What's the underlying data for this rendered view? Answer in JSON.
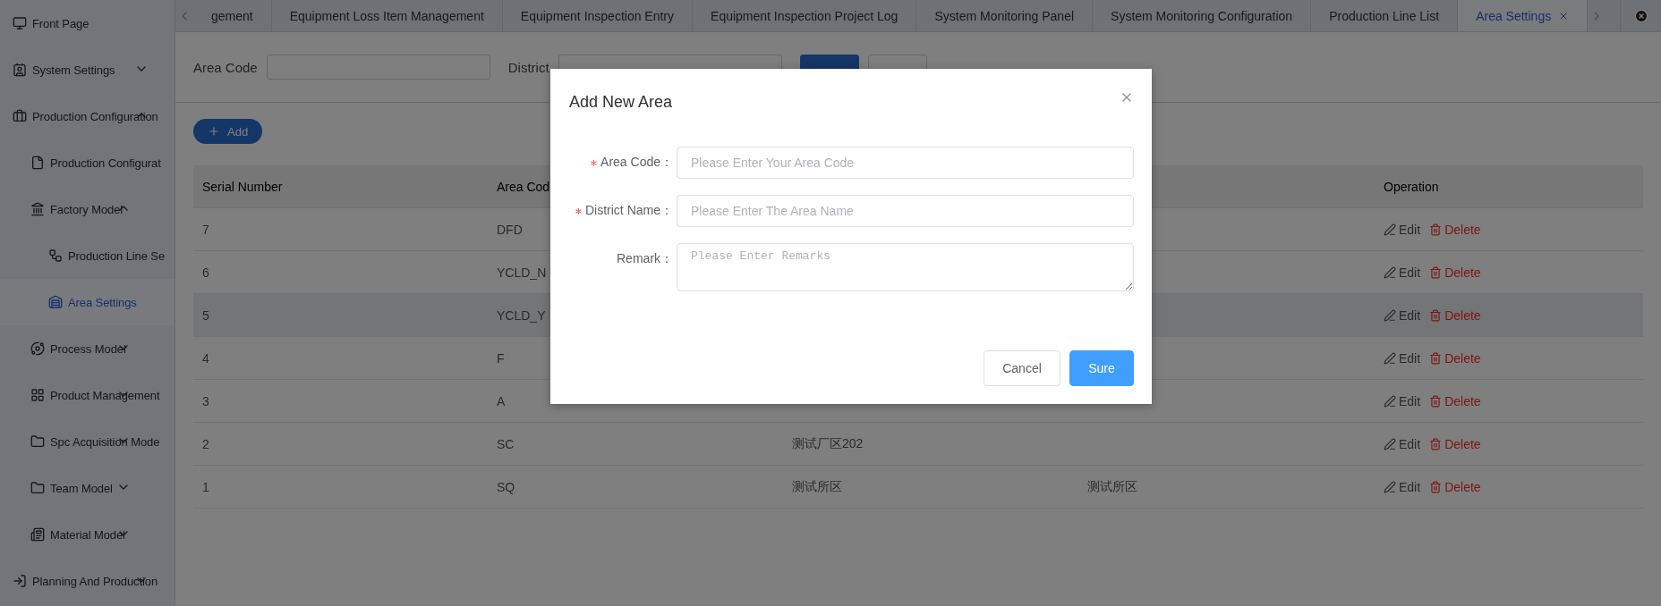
{
  "sidebar": {
    "items": [
      {
        "label": "Front Page",
        "selected": false
      },
      {
        "label": "System Settings",
        "kind": "group",
        "expanded": false,
        "selected": false
      },
      {
        "label": "Production Configuration",
        "kind": "group",
        "expanded": true,
        "selected": false,
        "children": [
          {
            "label": "Production Configurat",
            "selected": false
          },
          {
            "label": "Factory Model",
            "kind": "group",
            "expanded": true,
            "selected": false,
            "children": [
              {
                "label": "Production Line Se",
                "selected": false
              },
              {
                "label": "Area Settings",
                "selected": true
              }
            ]
          },
          {
            "label": "Process Model",
            "kind": "group",
            "expanded": false,
            "selected": false
          },
          {
            "label": "Product Management",
            "kind": "group",
            "expanded": false,
            "selected": false
          },
          {
            "label": "Spc Acquisition Mode",
            "kind": "group",
            "expanded": false,
            "selected": false
          },
          {
            "label": "Team Model",
            "kind": "group",
            "expanded": false,
            "selected": false
          },
          {
            "label": "Material Model",
            "kind": "group",
            "expanded": false,
            "selected": false
          }
        ]
      },
      {
        "label": "Planning And Production",
        "kind": "group",
        "expanded": false,
        "selected": false
      }
    ]
  },
  "tabs": [
    {
      "label": "gement",
      "selected": false
    },
    {
      "label": "Equipment Loss Item Management",
      "selected": false
    },
    {
      "label": "Equipment Inspection Entry",
      "selected": false
    },
    {
      "label": "Equipment Inspection Project Log",
      "selected": false
    },
    {
      "label": "System Monitoring Panel",
      "selected": false
    },
    {
      "label": "System Monitoring Configuration",
      "selected": false
    },
    {
      "label": "Production Line List",
      "selected": false
    },
    {
      "label": "Area Settings",
      "selected": true
    }
  ],
  "filters": [
    {
      "label": "Area Code"
    },
    {
      "label": "District"
    }
  ],
  "add_button": "Add",
  "table": {
    "columns": [
      "Serial Number",
      "Area Cod",
      null,
      null,
      "Operation"
    ],
    "rows": [
      {
        "highlighted": false,
        "cells": [
          "7",
          "DFD",
          null,
          null
        ],
        "actions": [
          "Edit",
          "Delete"
        ]
      },
      {
        "highlighted": false,
        "cells": [
          "6",
          "YCLD_N",
          null,
          null
        ],
        "actions": [
          "Edit",
          "Delete"
        ]
      },
      {
        "highlighted": true,
        "cells": [
          "5",
          "YCLD_Y",
          null,
          null
        ],
        "actions": [
          "Edit",
          "Delete"
        ]
      },
      {
        "highlighted": false,
        "cells": [
          "4",
          "F",
          null,
          null
        ],
        "actions": [
          "Edit",
          "Delete"
        ]
      },
      {
        "highlighted": false,
        "cells": [
          "3",
          "A",
          null,
          null
        ],
        "actions": [
          "Edit",
          "Delete"
        ]
      },
      {
        "highlighted": false,
        "cells": [
          "2",
          "SC",
          "测试厂区202",
          null
        ],
        "actions": [
          "Edit",
          "Delete"
        ]
      },
      {
        "highlighted": false,
        "cells": [
          "1",
          "SQ",
          "测试所区",
          "测试所区"
        ],
        "actions": [
          "Edit",
          "Delete"
        ]
      }
    ]
  },
  "dialog": {
    "title": "Add New Area",
    "fields": [
      {
        "label": "Area Code：",
        "required": true,
        "kind": "input",
        "placeholder": "Please Enter Your Area Code"
      },
      {
        "label": "District Name：",
        "required": true,
        "kind": "input",
        "placeholder": "Please Enter The Area Name"
      },
      {
        "label": "Remark：",
        "required": false,
        "kind": "textarea",
        "placeholder": "Please Enter Remarks"
      }
    ],
    "buttons": [
      {
        "label": "Cancel",
        "kind": "default"
      },
      {
        "label": "Sure",
        "kind": "primary"
      }
    ]
  }
}
